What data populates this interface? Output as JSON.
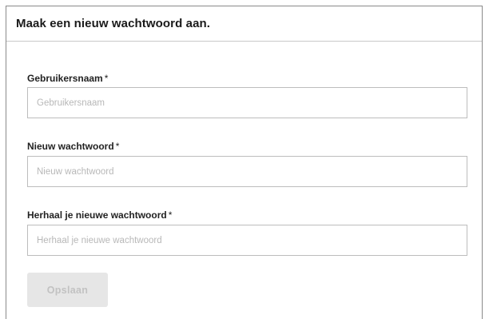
{
  "form": {
    "title": "Maak een nieuw wachtwoord aan.",
    "fields": [
      {
        "label": "Gebruikersnaam",
        "required_marker": "*",
        "placeholder": "Gebruikersnaam",
        "value": ""
      },
      {
        "label": "Nieuw wachtwoord",
        "required_marker": "*",
        "placeholder": "Nieuw wachtwoord",
        "value": ""
      },
      {
        "label": "Herhaal je nieuwe wachtwoord",
        "required_marker": "*",
        "placeholder": "Herhaal je nieuwe wachtwoord",
        "value": ""
      }
    ],
    "save_label": "Opslaan",
    "save_disabled": true
  },
  "colors": {
    "border": "#bdbdbd",
    "button_bg": "#e6e6e6",
    "button_text": "#c2c2c2",
    "placeholder": "#b8b8b8"
  }
}
